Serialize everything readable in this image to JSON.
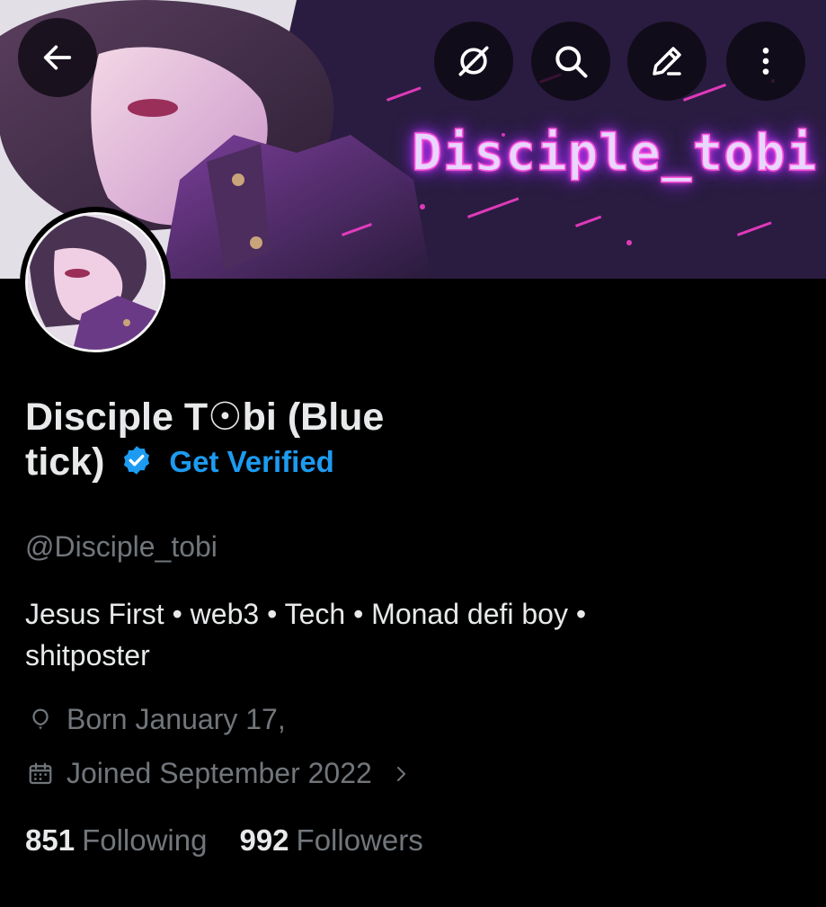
{
  "banner": {
    "overlay_text": "Disciple_tobi"
  },
  "top_bar": {
    "back_icon": "arrow-left-icon",
    "grok_icon": "grok-icon",
    "search_icon": "search-icon",
    "edit_icon": "edit-pencil-icon",
    "more_icon": "more-vertical-icon"
  },
  "profile": {
    "name_line1": "Disciple T☉bi (Blue",
    "name_line2": "tick)",
    "verified_icon": "verified-badge-icon",
    "get_verified": "Get Verified",
    "handle": "@Disciple_tobi",
    "bio_line1": "Jesus First • web3 • Tech • Monad defi boy •",
    "bio_line2": "shitposter",
    "birthday": "Born January 17,",
    "joined": "Joined September 2022"
  },
  "stats": {
    "following_count": "851",
    "following_label": "Following",
    "followers_count": "992",
    "followers_label": "Followers"
  },
  "colors": {
    "background": "#000000",
    "text_primary": "#e7e9ea",
    "text_secondary": "#71767b",
    "accent": "#1d9bf0",
    "neon": "#ff4fd8"
  }
}
